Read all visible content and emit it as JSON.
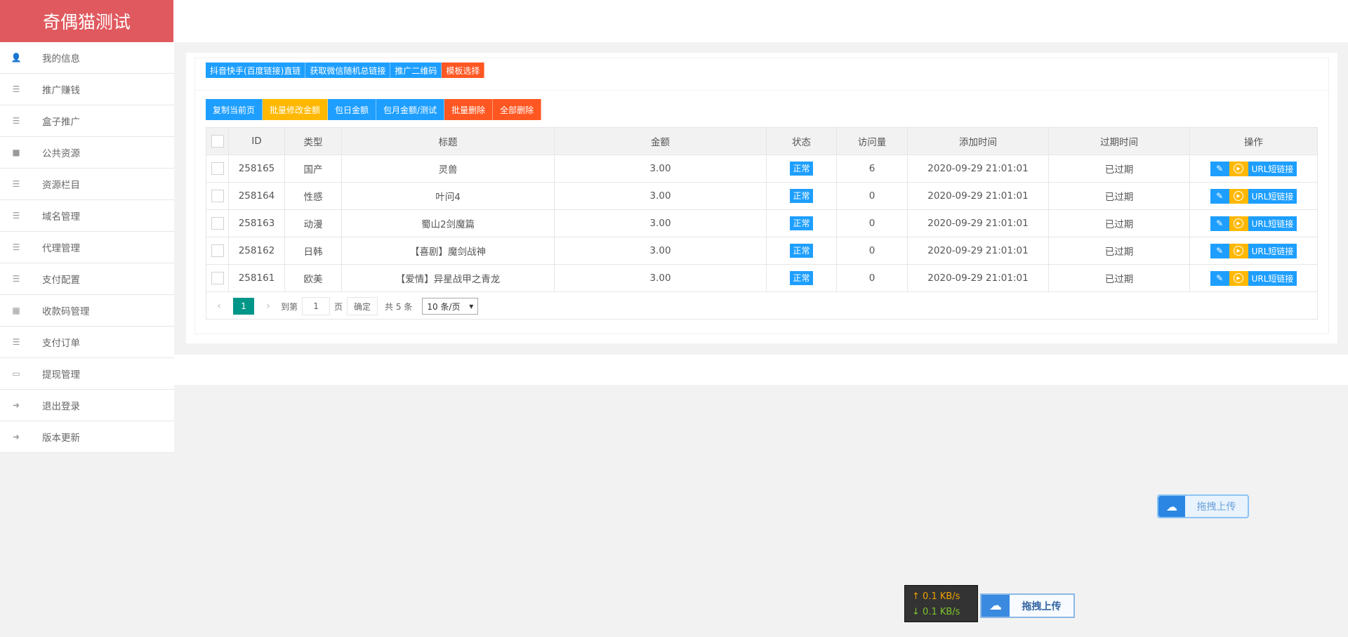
{
  "app": {
    "title": "奇偶猫测试"
  },
  "sidebar": {
    "items": [
      {
        "label": "我的信息",
        "icon": "user-icon"
      },
      {
        "label": "推广赚钱",
        "icon": "list-icon"
      },
      {
        "label": "盒子推广",
        "icon": "list-icon"
      },
      {
        "label": "公共资源",
        "icon": "video-icon"
      },
      {
        "label": "资源栏目",
        "icon": "list-icon"
      },
      {
        "label": "域名管理",
        "icon": "list-icon"
      },
      {
        "label": "代理管理",
        "icon": "list-icon"
      },
      {
        "label": "支付配置",
        "icon": "list-icon"
      },
      {
        "label": "收款码管理",
        "icon": "qrcode-icon"
      },
      {
        "label": "支付订单",
        "icon": "list-icon"
      },
      {
        "label": "提现管理",
        "icon": "money-icon"
      },
      {
        "label": "退出登录",
        "icon": "signout-icon"
      },
      {
        "label": "版本更新",
        "icon": "signin-icon"
      }
    ]
  },
  "toolbar1": [
    {
      "label": "抖音快手(百度链接)直链",
      "color": "#1e9fff"
    },
    {
      "label": "获取微信随机总链接",
      "color": "#1e9fff"
    },
    {
      "label": "推广二维码",
      "color": "#1e9fff"
    },
    {
      "label": "模板选择",
      "color": "#ff5722"
    }
  ],
  "toolbar2": [
    {
      "label": "复制当前页",
      "color": "#1e9fff"
    },
    {
      "label": "批量修改金额",
      "color": "#ffb800"
    },
    {
      "label": "包日金额",
      "color": "#1e9fff"
    },
    {
      "label": "包月金额/测试",
      "color": "#1e9fff"
    },
    {
      "label": "批量删除",
      "color": "#ff5722"
    },
    {
      "label": "全部删除",
      "color": "#ff5722"
    }
  ],
  "table": {
    "headers": [
      "ID",
      "类型",
      "标题",
      "金额",
      "状态",
      "访问量",
      "添加时间",
      "过期时间",
      "操作"
    ],
    "rows": [
      {
        "id": "258165",
        "type": "国产",
        "title": "灵兽",
        "amount": "3.00",
        "status": "正常",
        "visits": "6",
        "added": "2020-09-29 21:01:01",
        "expire": "已过期"
      },
      {
        "id": "258164",
        "type": "性感",
        "title": "叶问4",
        "amount": "3.00",
        "status": "正常",
        "visits": "0",
        "added": "2020-09-29 21:01:01",
        "expire": "已过期"
      },
      {
        "id": "258163",
        "type": "动漫",
        "title": "蜀山2剑魔篇",
        "amount": "3.00",
        "status": "正常",
        "visits": "0",
        "added": "2020-09-29 21:01:01",
        "expire": "已过期"
      },
      {
        "id": "258162",
        "type": "日韩",
        "title": "【喜剧】魔剑战神",
        "amount": "3.00",
        "status": "正常",
        "visits": "0",
        "added": "2020-09-29 21:01:01",
        "expire": "已过期"
      },
      {
        "id": "258161",
        "type": "欧美",
        "title": "【爱情】异星战甲之青龙",
        "amount": "3.00",
        "status": "正常",
        "visits": "0",
        "added": "2020-09-29 21:01:01",
        "expire": "已过期"
      }
    ],
    "op_url_label": "URL短链接"
  },
  "pager": {
    "current": "1",
    "goto_label": "到第",
    "page_input": "1",
    "page_unit": "页",
    "confirm": "确定",
    "total": "共 5 条",
    "page_size": "10 条/页"
  },
  "upload1": {
    "label": "拖拽上传"
  },
  "speed": {
    "up": "0.1 KB/s",
    "down": "0.1 KB/s"
  },
  "upload2": {
    "label": "拖拽上传"
  }
}
